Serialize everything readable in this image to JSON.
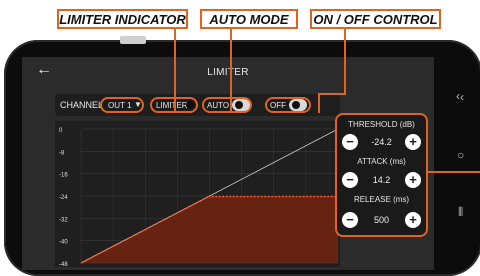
{
  "callouts": {
    "limiter": "LIMITER INDICATOR",
    "auto": "AUTO MODE",
    "onoff": "ON / OFF CONTROL"
  },
  "screen": {
    "back_icon": "←",
    "title": "LIMITER"
  },
  "controls": {
    "channel_label": "CHANNEL",
    "output_value": "OUT 1",
    "limiter_label": "LIMITER",
    "auto_label": "AUTO",
    "off_label": "OFF"
  },
  "chart_data": {
    "type": "line",
    "ylim": [
      -48,
      0
    ],
    "yticks": [
      "0",
      "-8",
      "-16",
      "-24",
      "-32",
      "-40",
      "-48"
    ],
    "threshold_db": -24.2,
    "series": [
      {
        "values": [
          -48,
          -24.2,
          -24.2
        ]
      }
    ],
    "reference_line": [
      -48,
      0
    ],
    "colors": {
      "curve": "#ff5a2a",
      "fill": "#6b2411",
      "grid": "#3a3a3a",
      "reference": "#cfcfcf"
    }
  },
  "panel": {
    "threshold_label": "THRESHOLD (dB)",
    "threshold_value": "-24.2",
    "attack_label": "ATTACK (ms)",
    "attack_value": "14.2",
    "release_label": "RELEASE (ms)",
    "release_value": "500",
    "minus": "−",
    "plus": "+"
  },
  "nav": {
    "back": "‹",
    "home": "○",
    "recents": "⦀"
  },
  "colors": {
    "accent": "#e0641e"
  }
}
